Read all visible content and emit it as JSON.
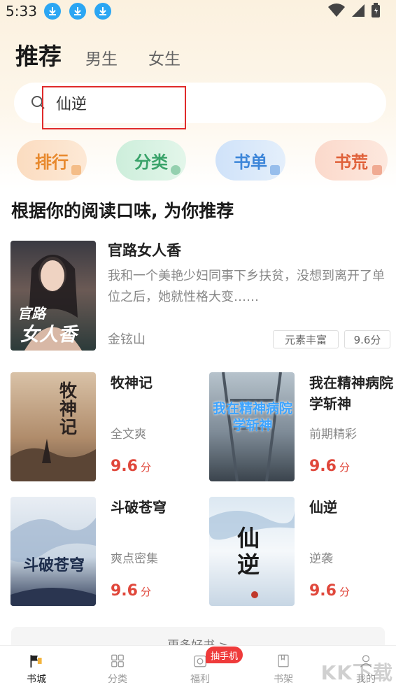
{
  "status": {
    "time": "5:33"
  },
  "header": {
    "tabs": [
      "推荐",
      "男生",
      "女生"
    ]
  },
  "search": {
    "value": "仙逆"
  },
  "quick_actions": [
    {
      "label": "排行",
      "color": "#e8892d"
    },
    {
      "label": "分类",
      "color": "#3aa36a"
    },
    {
      "label": "书单",
      "color": "#3d86d9"
    },
    {
      "label": "书荒",
      "color": "#e0613a"
    }
  ],
  "section": {
    "title": "根据你的阅读口味, 为你推荐"
  },
  "featured": {
    "title": "官路女人香",
    "desc": "我和一个美艳少妇同事下乡扶贫，没想到离开了单位之后，她就性格大变……",
    "author": "金铉山",
    "tags": [
      "元素丰富",
      "9.6分"
    ],
    "cover_text": [
      "官路",
      "女人香"
    ]
  },
  "books": [
    {
      "title": "牧神记",
      "tag": "全文爽",
      "score": "9.6",
      "unit": "分",
      "cover_text": "牧神记"
    },
    {
      "title": "我在精神病院学斩神",
      "tag": "前期精彩",
      "score": "9.6",
      "unit": "分",
      "cover_text": "我在精神病院学斩神"
    },
    {
      "title": "斗破苍穹",
      "tag": "爽点密集",
      "score": "9.6",
      "unit": "分",
      "cover_text": "斗破苍穹"
    },
    {
      "title": "仙逆",
      "tag": "逆袭",
      "score": "9.6",
      "unit": "分",
      "cover_text": "仙逆"
    }
  ],
  "more": {
    "label": "更多好书 >"
  },
  "nav": {
    "items": [
      "书城",
      "分类",
      "福利",
      "书架",
      "我的"
    ],
    "badge": "抽手机"
  },
  "watermark": "KK下载"
}
